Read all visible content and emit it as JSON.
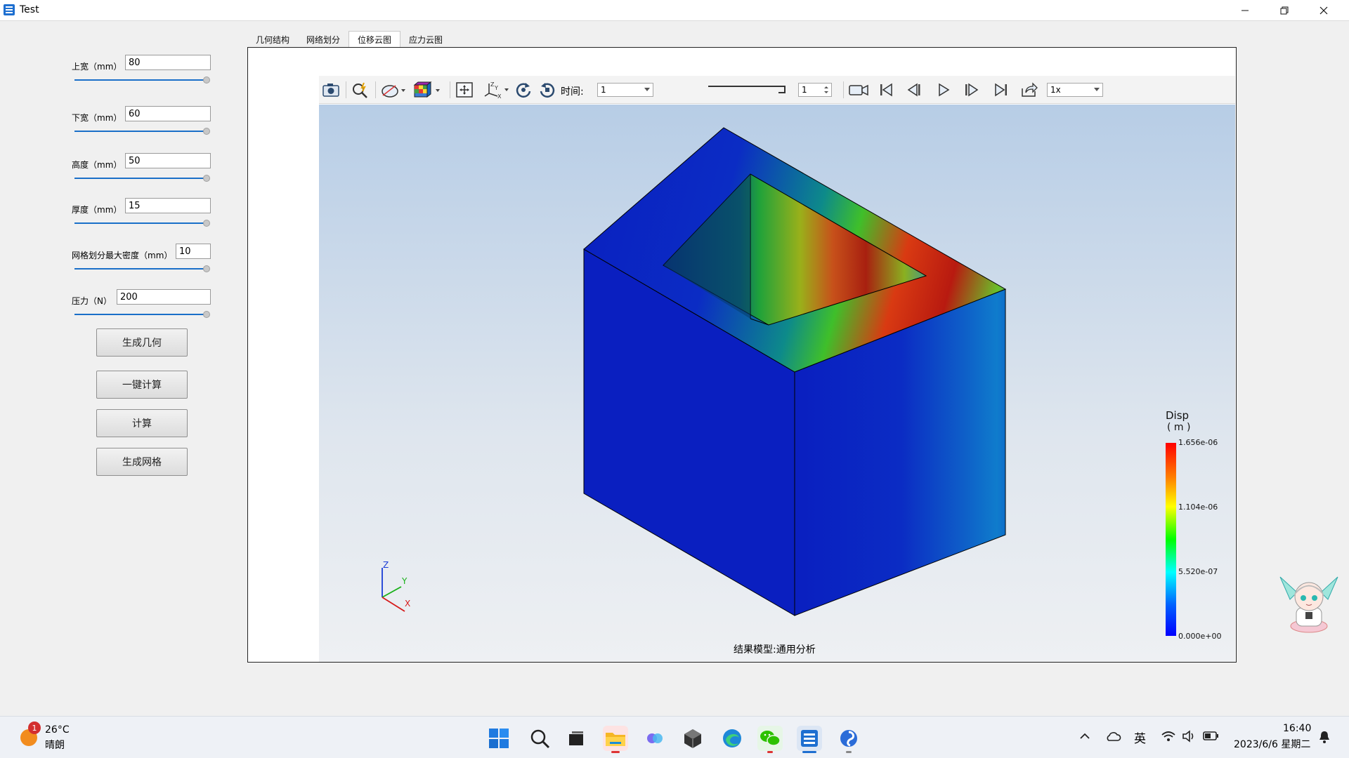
{
  "window": {
    "title": "Test"
  },
  "params": [
    {
      "label": "上宽（mm）",
      "value": "80"
    },
    {
      "label": "下宽（mm）",
      "value": "60"
    },
    {
      "label": "高度（mm）",
      "value": "50"
    },
    {
      "label": "厚度（mm）",
      "value": "15"
    },
    {
      "label": "网格划分最大密度（mm）",
      "value": "10"
    },
    {
      "label": "压力（N）",
      "value": "200"
    }
  ],
  "buttons": {
    "generate_geometry": "生成几何",
    "one_click_compute": "一键计算",
    "compute": "计算",
    "generate_mesh": "生成网格"
  },
  "tabs": [
    "几何结构",
    "网络划分",
    "位移云图",
    "应力云图"
  ],
  "active_tab": "位移云图",
  "toolbar": {
    "time_label": "时间:",
    "time_value": "1",
    "frame_value": "1",
    "speed_value": "1x"
  },
  "viewport": {
    "result_label": "结果模型:通用分析",
    "legend_title": "Disp",
    "legend_unit": "( m )",
    "legend_ticks": [
      "1.656e-06",
      "1.104e-06",
      "5.520e-07",
      "0.000e+00"
    ],
    "axis_labels": {
      "x": "X",
      "y": "Y",
      "z": "Z"
    }
  },
  "taskbar": {
    "weather_temp": "26°C",
    "weather_desc": "晴朗",
    "weather_badge": "1",
    "ime": "英",
    "time": "16:40",
    "date": "2023/6/6 星期二"
  },
  "colors": {
    "accent": "#1a6fc8",
    "viewport_top": "#b7cde6",
    "legend_max": "#ff0000",
    "legend_min": "#0000ff"
  }
}
